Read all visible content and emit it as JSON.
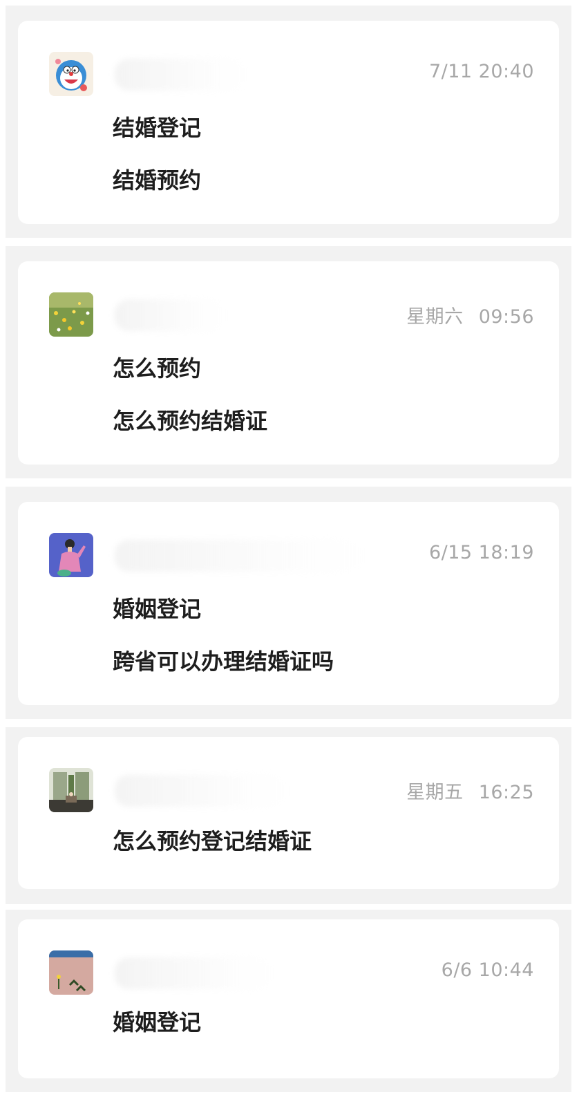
{
  "conversations": [
    {
      "avatar_icon": "cartoon-cat-avatar-icon",
      "time": "7/11 20:40",
      "weekday": "",
      "messages": [
        "结婚登记",
        "结婚预约"
      ]
    },
    {
      "avatar_icon": "flower-field-avatar-icon",
      "weekday": "星期六",
      "time": "09:56",
      "messages": [
        "怎么预约",
        "怎么预约结婚证"
      ]
    },
    {
      "avatar_icon": "illustrated-person-avatar-icon",
      "time": "6/15 18:19",
      "weekday": "",
      "messages": [
        "婚姻登记",
        "跨省可以办理结婚证吗"
      ]
    },
    {
      "avatar_icon": "building-photo-avatar-icon",
      "weekday": "星期五",
      "time": "16:25",
      "messages": [
        "怎么预约登记结婚证"
      ]
    },
    {
      "avatar_icon": "desert-plant-avatar-icon",
      "time": "6/6 10:44",
      "weekday": "",
      "messages": [
        "婚姻登记"
      ]
    }
  ],
  "colors": {
    "panel_background": "#f2f2f2",
    "card_background": "#ffffff",
    "time_text": "#a7a7a7",
    "message_text": "#1e1e1e"
  }
}
